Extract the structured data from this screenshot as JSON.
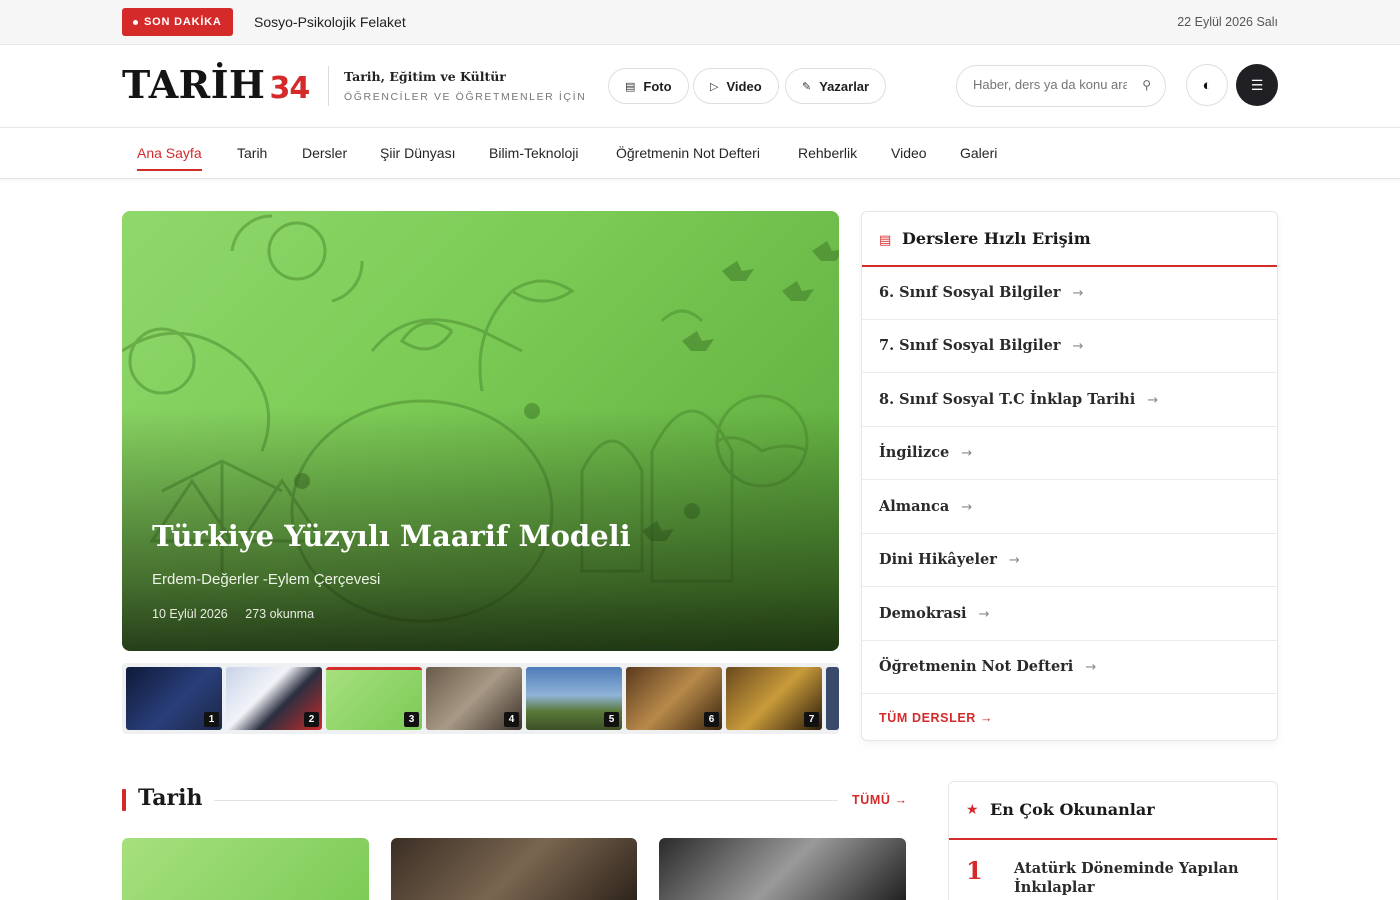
{
  "topbar": {
    "breaking_label": "SON DAKİKA",
    "breaking_text": "Sosyo-Psikolojik Felaket",
    "date": "22 Eylül 2026 Salı"
  },
  "header": {
    "logo_text": "TARİH",
    "logo_num": "34",
    "tagline_1": "Tarih, Eğitim ve Kültür",
    "tagline_2": "ÖĞRENCİLER VE ÖĞRETMENLER İÇİN",
    "pills": [
      {
        "label": "Foto",
        "icon": "image-icon"
      },
      {
        "label": "Video",
        "icon": "play-icon"
      },
      {
        "label": "Yazarlar",
        "icon": "pen-icon"
      }
    ],
    "search_placeholder": "Haber, ders ya da konu ara",
    "theme_icon": "contrast-icon",
    "menu_icon": "hamburger-icon"
  },
  "nav": {
    "items": [
      "Ana Sayfa",
      "Tarih",
      "Dersler",
      "Şiir Dünyası",
      "Bilim-Teknoloji",
      "Öğretmenin Not Defteri",
      "Rehberlik",
      "Video",
      "Galeri"
    ],
    "active": "Ana Sayfa"
  },
  "hero": {
    "title": "Türkiye Yüzyılı Maarif Modeli",
    "subtitle": "Erdem-Değerler -Eylem Çerçevesi",
    "date": "10 Eylül 2026",
    "reads": "273 okunma"
  },
  "thumbs": {
    "numbers": [
      "1",
      "2",
      "3",
      "4",
      "5",
      "6",
      "7"
    ],
    "active_index": 3
  },
  "lessons": {
    "title": "Derslere Hızlı Erişim",
    "items": [
      "6. Sınıf Sosyal Bilgiler",
      "7. Sınıf Sosyal Bilgiler",
      "8. Sınıf Sosyal T.C İnklap Tarihi",
      "İngilizce",
      "Almanca",
      "Dini Hikâyeler",
      "Demokrasi",
      "Öğretmenin Not Defteri"
    ],
    "all_label": "TÜM DERSLER →",
    "arrow": "→"
  },
  "section": {
    "title": "Tarih",
    "all_label": "TÜMÜ →"
  },
  "most_read": {
    "title": "En Çok Okunanlar",
    "items": [
      {
        "rank": "1",
        "title": "Atatürk Döneminde Yapılan İnkılaplar"
      }
    ]
  },
  "colors": {
    "accent": "#d42a2a",
    "dark": "#1f1f24",
    "hero_green": "#7ccb56"
  }
}
